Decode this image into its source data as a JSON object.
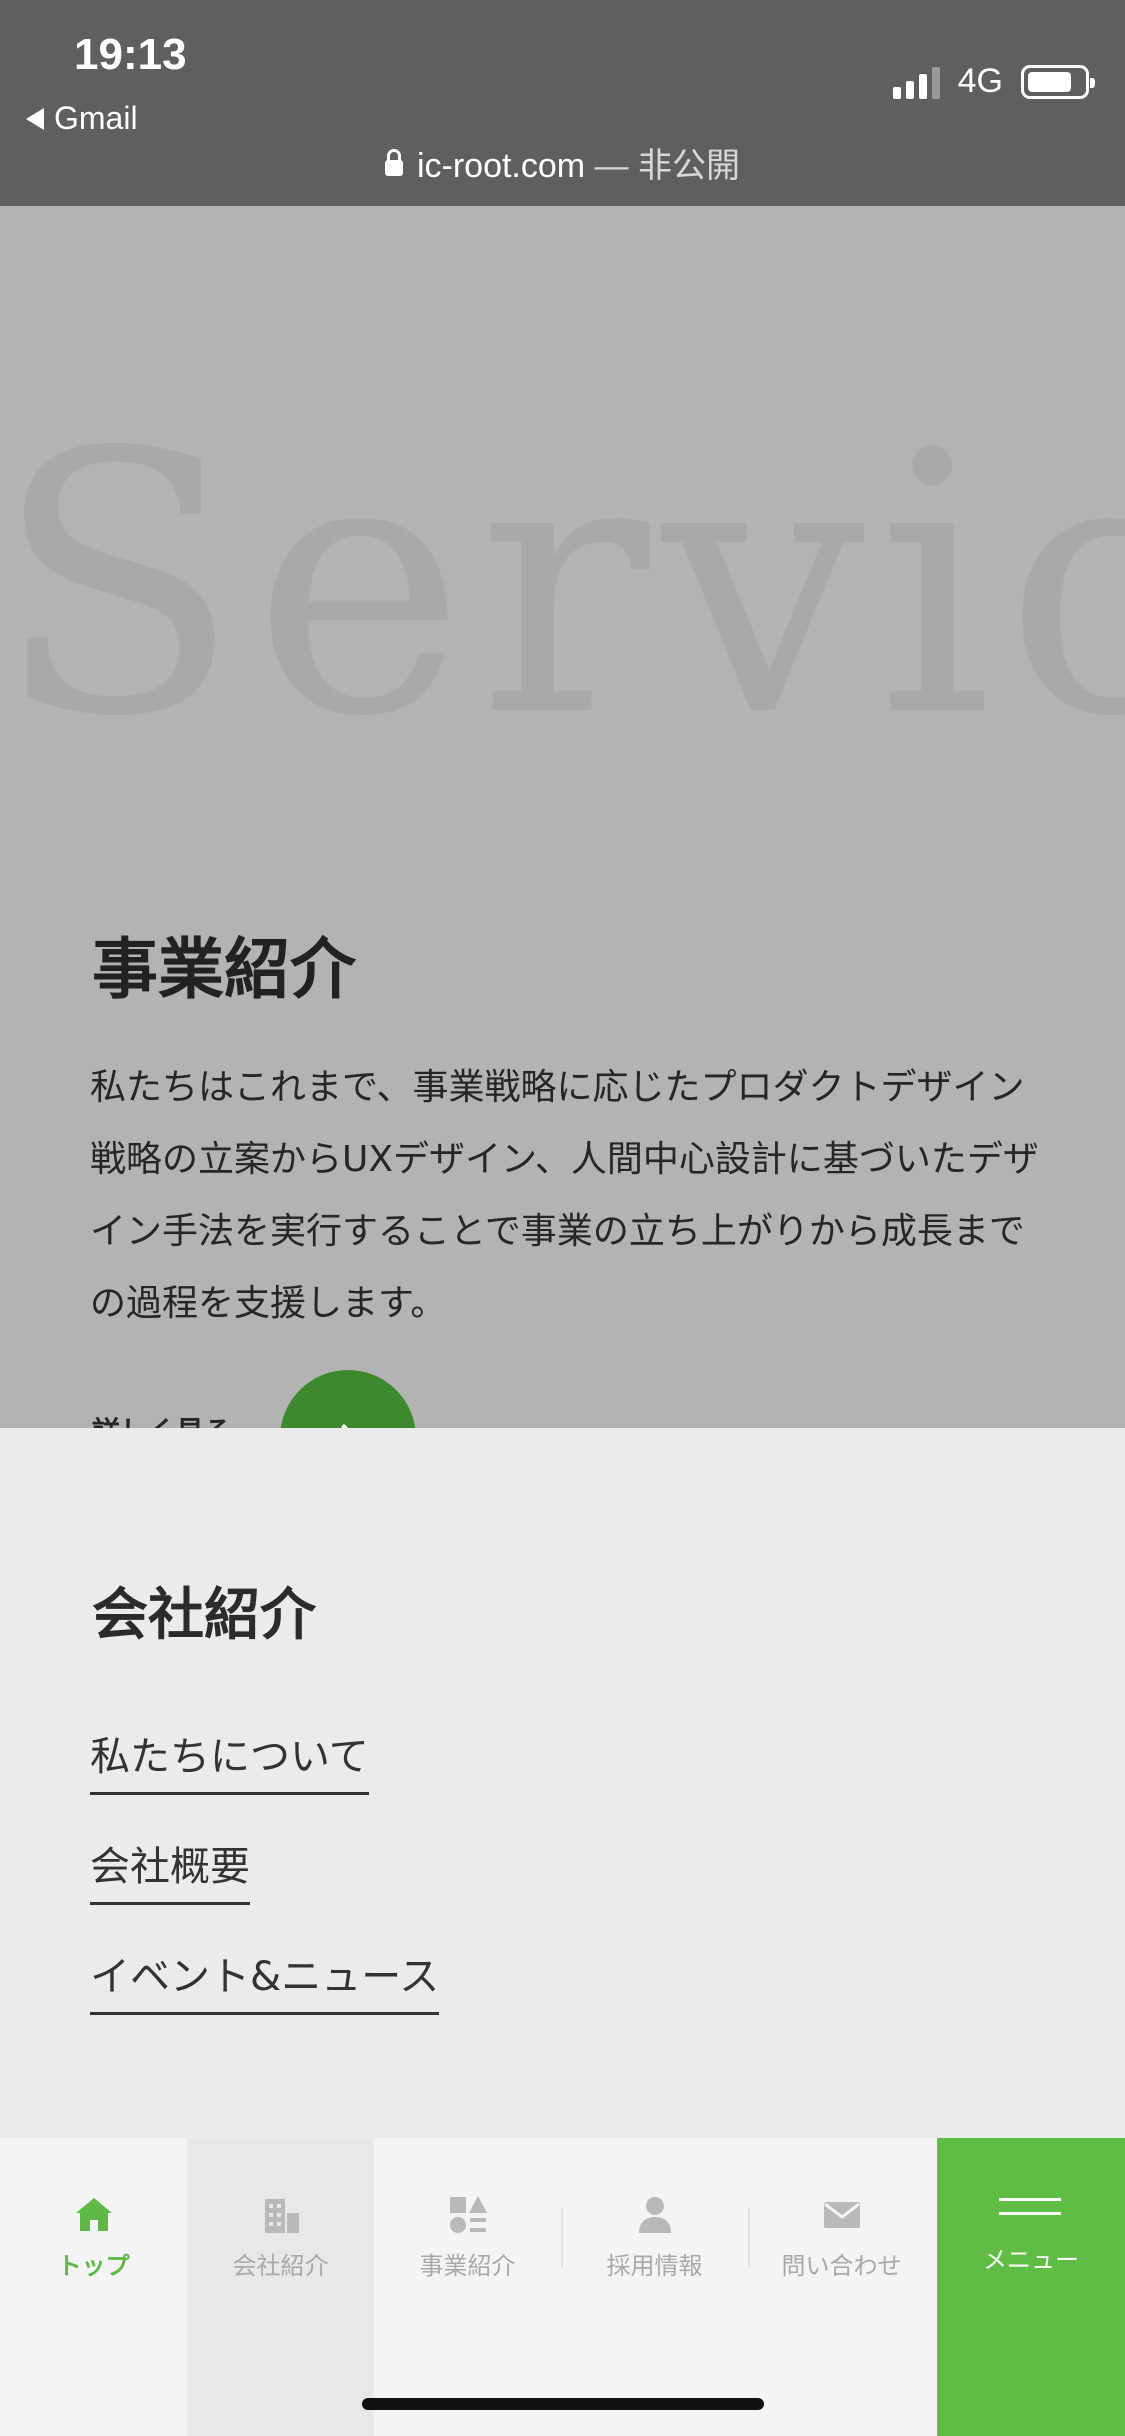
{
  "status_bar": {
    "time": "19:13",
    "back_app": "Gmail",
    "network": "4G",
    "url": "ic-root.com",
    "private_label": " — 非公開"
  },
  "services": {
    "background_word": "Servic",
    "title": "事業紹介",
    "body": "私たちはこれまで、事業戦略に応じたプロダクトデザイン戦略の立案からUXデザイン、人間中心設計に基づいたデザイン手法を実行することで事業の立ち上がりから成長までの過程を支援します。",
    "more_label": "詳しく見る"
  },
  "menu_panel": {
    "title": "会社紹介",
    "links": [
      "私たちについて",
      "会社概要",
      "イベント&ニュース"
    ]
  },
  "tabbar": {
    "tabs": [
      {
        "label": "トップ",
        "icon": "home-icon"
      },
      {
        "label": "会社紹介",
        "icon": "building-icon"
      },
      {
        "label": "事業紹介",
        "icon": "shapes-icon"
      },
      {
        "label": "採用情報",
        "icon": "person-icon"
      },
      {
        "label": "問い合わせ",
        "icon": "mail-icon"
      }
    ],
    "menu_label": "メニュー"
  },
  "colors": {
    "accent_green": "#5fbd45",
    "dark_green_button": "#3c8a2d"
  }
}
